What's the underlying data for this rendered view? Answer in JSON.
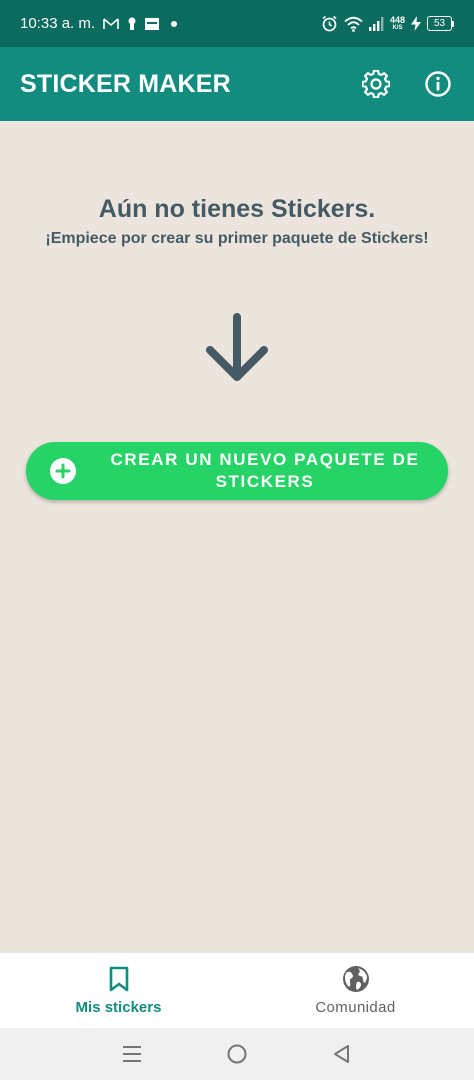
{
  "status_bar": {
    "time": "10:33 a. m.",
    "net_speed_value": "448",
    "net_speed_unit": "K/S",
    "battery": "53",
    "icons": [
      "gmail-icon",
      "keyhole-icon",
      "card-icon",
      "dot-icon",
      "alarm-icon",
      "wifi-icon",
      "signal-icon",
      "charging-icon",
      "battery-icon"
    ]
  },
  "app_bar": {
    "title": "STICKER MAKER",
    "actions": [
      "settings-icon",
      "info-icon"
    ]
  },
  "empty_state": {
    "title": "Aún no tienes Stickers.",
    "subtitle": "¡Empiece por crear su primer paquete de Stickers!",
    "arrow_icon": "arrow-down-icon"
  },
  "create_button": {
    "label": "CREAR UN NUEVO PAQUETE DE STICKERS",
    "icon": "plus-circle-icon"
  },
  "bottom_nav": {
    "tabs": [
      {
        "label": "Mis stickers",
        "icon": "bookmark-icon",
        "active": true
      },
      {
        "label": "Comunidad",
        "icon": "globe-icon",
        "active": false
      }
    ]
  },
  "system_nav": [
    "menu-icon",
    "home-icon",
    "back-icon"
  ],
  "colors": {
    "status_bar": "#0b6b5e",
    "app_bar": "#128c7e",
    "background": "#ece5dd",
    "primary_text": "#455a64",
    "button": "#25d366",
    "active_tab": "#128c7e"
  }
}
